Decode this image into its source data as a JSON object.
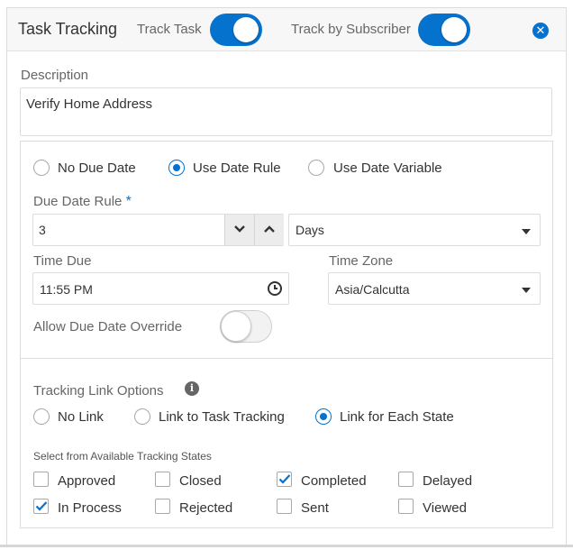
{
  "header": {
    "title": "Task Tracking",
    "track_task_label": "Track Task",
    "track_task_on": true,
    "track_subscriber_label": "Track by Subscriber",
    "track_subscriber_on": true,
    "close_icon": "close-icon",
    "close_glyph": "✕"
  },
  "description": {
    "label": "Description",
    "value": "Verify Home Address"
  },
  "due_date": {
    "options": [
      {
        "label": "No Due Date",
        "checked": false
      },
      {
        "label": "Use Date Rule",
        "checked": true
      },
      {
        "label": "Use Date Variable",
        "checked": false
      }
    ],
    "rule_label": "Due Date Rule",
    "rule_required_mark": "*",
    "rule_value": "3",
    "rule_unit": "Days",
    "time_due_label": "Time Due",
    "time_due_value": "11:55 PM",
    "time_zone_label": "Time Zone",
    "time_zone_value": "Asia/Calcutta",
    "override_label": "Allow Due Date Override",
    "override_on": false
  },
  "tracking": {
    "options_label": "Tracking Link Options",
    "info_glyph": "i",
    "link_options": [
      {
        "label": "No Link",
        "checked": false
      },
      {
        "label": "Link to Task Tracking",
        "checked": false
      },
      {
        "label": "Link for Each State",
        "checked": true
      }
    ],
    "states_label": "Select from Available Tracking States",
    "states": [
      {
        "label": "Approved",
        "checked": false
      },
      {
        "label": "Closed",
        "checked": false
      },
      {
        "label": "Completed",
        "checked": true
      },
      {
        "label": "Delayed",
        "checked": false
      },
      {
        "label": "In Process",
        "checked": true
      },
      {
        "label": "Rejected",
        "checked": false
      },
      {
        "label": "Sent",
        "checked": false
      },
      {
        "label": "Viewed",
        "checked": false
      }
    ]
  },
  "colors": {
    "accent": "#0572ce",
    "header_bg": "#f7f7f7",
    "border": "#dcdcdc"
  }
}
